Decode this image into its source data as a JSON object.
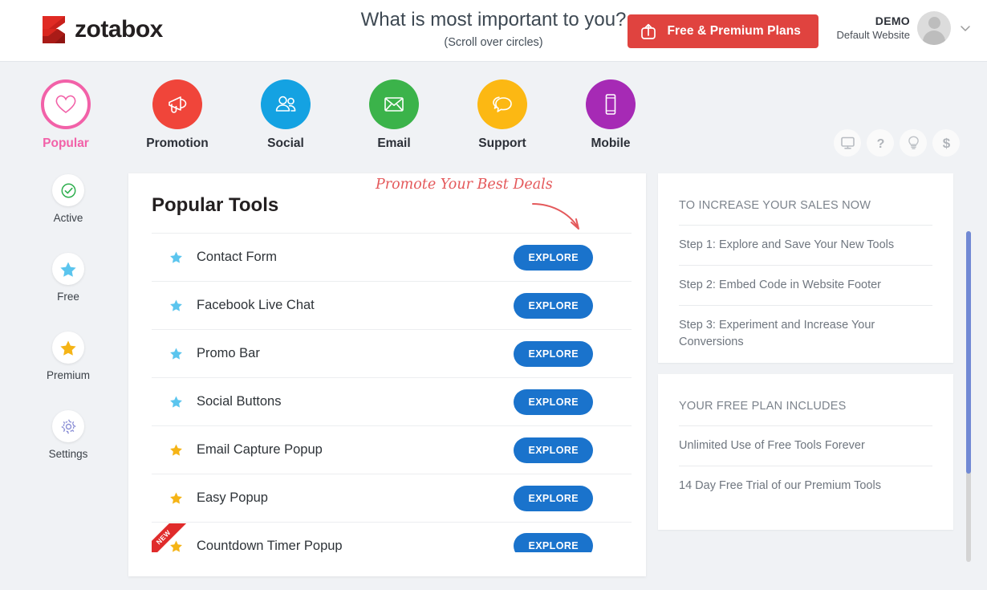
{
  "brand": {
    "name": "zotabox",
    "logo_icon": "zotabox-z-logo"
  },
  "header": {
    "title": "What is most important to you?",
    "subtitle": "(Scroll over circles)",
    "plans_button": {
      "label": "Free & Premium Plans",
      "icon": "upload-share-icon",
      "color": "#e0433f"
    },
    "account": {
      "name": "DEMO",
      "site": "Default Website",
      "avatar_icon": "user-avatar-icon",
      "chevron_icon": "chevron-down-icon"
    }
  },
  "categories": [
    {
      "label": "Popular",
      "icon": "heart-icon",
      "color": "#f261a8",
      "active": true
    },
    {
      "label": "Promotion",
      "icon": "megaphone-icon",
      "color": "#f0453a",
      "active": false
    },
    {
      "label": "Social",
      "icon": "people-icon",
      "color": "#14a2e2",
      "active": false
    },
    {
      "label": "Email",
      "icon": "envelope-icon",
      "color": "#3bb34a",
      "active": false
    },
    {
      "label": "Support",
      "icon": "chat-bubbles-icon",
      "color": "#fcb813",
      "active": false
    },
    {
      "label": "Mobile",
      "icon": "mobile-phone-icon",
      "color": "#a62ab5",
      "active": false
    }
  ],
  "utility_icons": [
    {
      "name": "monitor-icon"
    },
    {
      "name": "question-mark-icon"
    },
    {
      "name": "lightbulb-icon"
    },
    {
      "name": "dollar-sign-icon"
    }
  ],
  "rail": [
    {
      "label": "Active",
      "icon": "check-circle-icon",
      "color": "#2eaf4e"
    },
    {
      "label": "Free",
      "icon": "star-icon",
      "color": "#5bc5ee"
    },
    {
      "label": "Premium",
      "icon": "star-icon",
      "color": "#f5b416"
    },
    {
      "label": "Settings",
      "icon": "gear-icon",
      "color": "#8b8fd6"
    }
  ],
  "main": {
    "title": "Popular Tools",
    "annotation": "Promote Your Best Deals",
    "annotation_icon": "curved-arrow-icon",
    "explore_label": "EXPLORE",
    "new_badge": "NEW",
    "tools": [
      {
        "name": "Contact Form",
        "tier": "free",
        "new": false
      },
      {
        "name": "Facebook Live Chat",
        "tier": "free",
        "new": false
      },
      {
        "name": "Promo Bar",
        "tier": "free",
        "new": false
      },
      {
        "name": "Social Buttons",
        "tier": "free",
        "new": false
      },
      {
        "name": "Email Capture Popup",
        "tier": "premium",
        "new": false
      },
      {
        "name": "Easy Popup",
        "tier": "premium",
        "new": false
      },
      {
        "name": "Countdown Timer Popup",
        "tier": "premium",
        "new": true
      }
    ]
  },
  "side_panels": [
    {
      "heading": "TO INCREASE YOUR SALES NOW",
      "items": [
        "Step 1: Explore and Save Your New Tools",
        "Step 2: Embed Code in Website Footer",
        "Step 3: Experiment and Increase Your Conversions"
      ]
    },
    {
      "heading": "YOUR FREE PLAN INCLUDES",
      "items": [
        "Unlimited Use of Free Tools Forever",
        "14 Day Free Trial of our Premium Tools"
      ]
    }
  ],
  "colors": {
    "free_star": "#5bc5ee",
    "premium_star": "#f5b416",
    "explore_button": "#1a73cc",
    "accent_pink": "#f261a8",
    "annotation_red": "#e4595b",
    "page_bg": "#f0f2f5"
  }
}
